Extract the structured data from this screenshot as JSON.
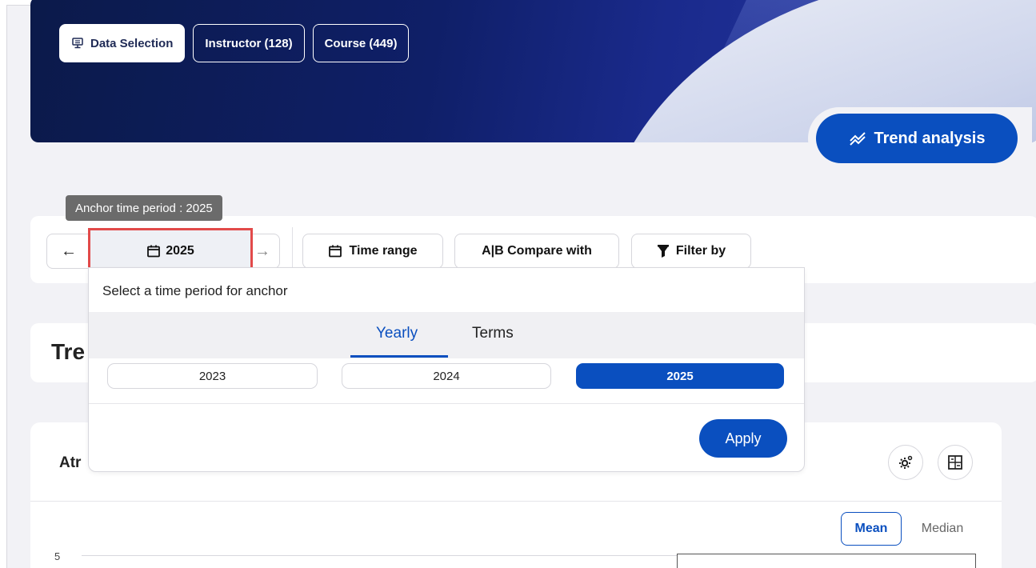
{
  "hero": {
    "tabs": [
      {
        "label": "Data Selection",
        "icon": "monitor-icon",
        "active": true
      },
      {
        "label": "Instructor (128)",
        "active": false
      },
      {
        "label": "Course (449)",
        "active": false
      }
    ],
    "trend_button_label": "Trend analysis"
  },
  "tooltip": {
    "text": "Anchor time period : 2025"
  },
  "toolbar": {
    "anchor_label": "2025",
    "time_range_label": "Time range",
    "compare_label": "A|B Compare with",
    "filter_label": "Filter by"
  },
  "section": {
    "title": "Tre"
  },
  "chart_card": {
    "title": "Atr",
    "mean_label": "Mean",
    "median_label": "Median",
    "y_tick": "5"
  },
  "popover": {
    "title": "Select a time period for anchor",
    "tabs": [
      {
        "label": "Yearly",
        "active": true
      },
      {
        "label": "Terms",
        "active": false
      }
    ],
    "years": [
      {
        "label": "2023",
        "selected": false
      },
      {
        "label": "2024",
        "selected": false
      },
      {
        "label": "2025",
        "selected": true
      }
    ],
    "apply_label": "Apply"
  },
  "colors": {
    "primary": "#0a4fbf",
    "highlight_border": "#e24a4a",
    "tooltip_bg": "#6b6b6b",
    "hero_dark": "#0b1a4a"
  }
}
